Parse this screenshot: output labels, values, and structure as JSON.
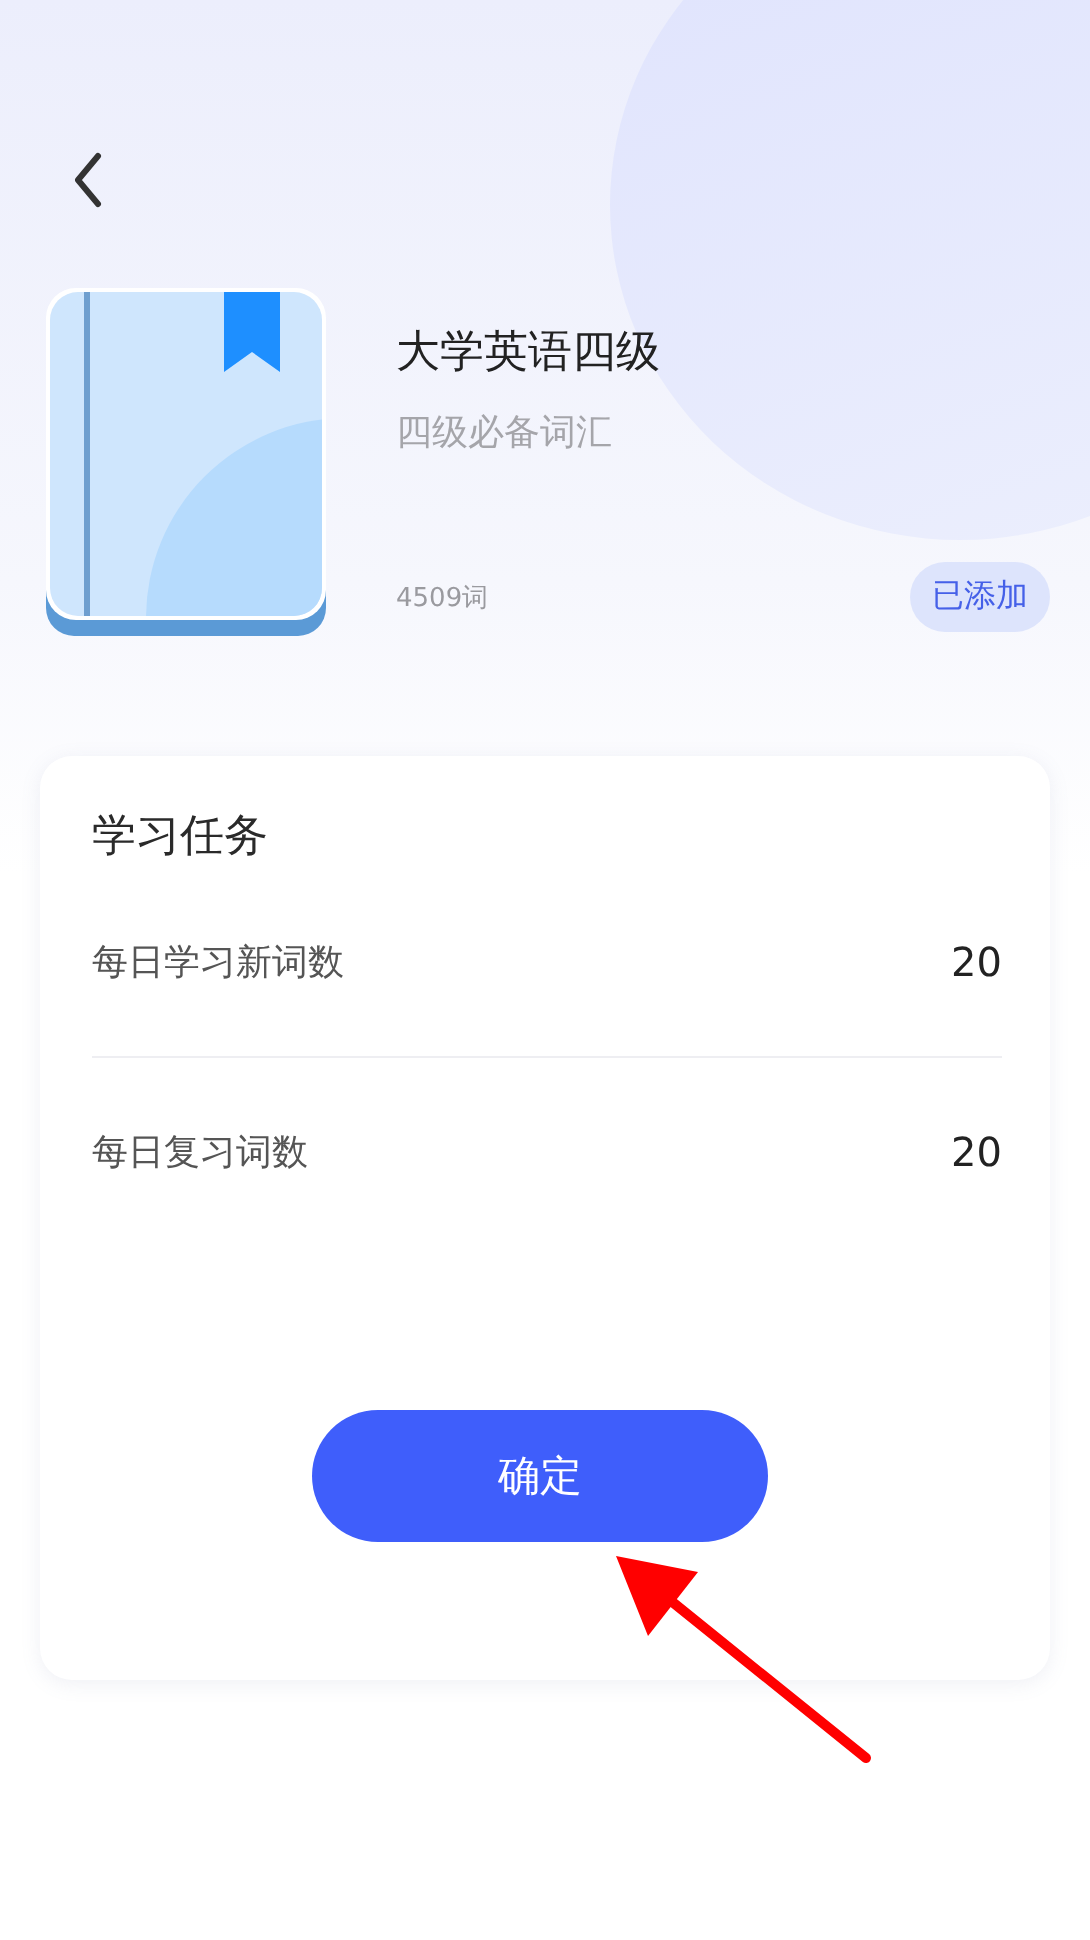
{
  "book": {
    "title": "大学英语四级",
    "subtitle": "四级必备词汇",
    "word_count": "4509词",
    "status_badge": "已添加"
  },
  "task_card": {
    "title": "学习任务",
    "rows": [
      {
        "label": "每日学习新词数",
        "value": "20"
      },
      {
        "label": "每日复习词数",
        "value": "20"
      }
    ]
  },
  "confirm_button": "确定"
}
